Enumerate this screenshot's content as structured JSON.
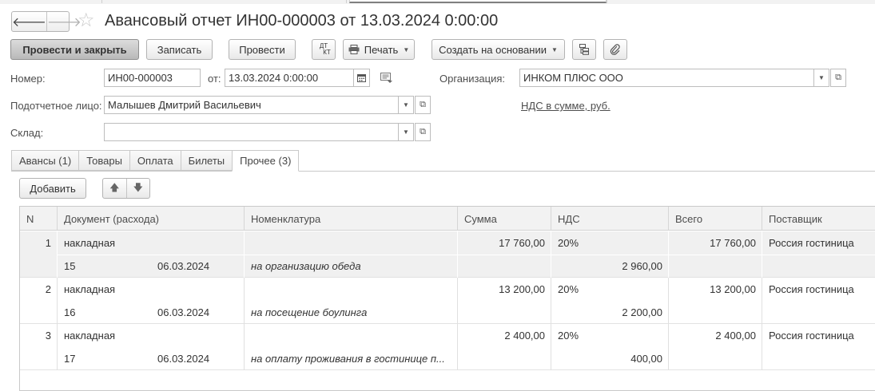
{
  "header": {
    "back": "🡐",
    "forward": "🡒",
    "star": "☆",
    "title": "Авансовый отчет ИН00-000003 от 13.03.2024 0:00:00"
  },
  "toolbar": {
    "post_close": "Провести и закрыть",
    "save": "Записать",
    "post": "Провести",
    "dtkt_top": "ДТ",
    "dtkt_bottom": "КТ",
    "print": "Печать",
    "create_based": "Создать на основании"
  },
  "form": {
    "number_label": "Номер:",
    "number_value": "ИН00-000003",
    "date_label": "от:",
    "date_value": "13.03.2024  0:00:00",
    "org_label": "Организация:",
    "org_value": "ИНКОМ ПЛЮС ООО",
    "person_label": "Подотчетное лицо:",
    "person_value": "Малышев Дмитрий Васильевич",
    "vat_link": "НДС в сумме, руб.",
    "warehouse_label": "Склад:",
    "warehouse_value": ""
  },
  "tabs": [
    "Авансы (1)",
    "Товары",
    "Оплата",
    "Билеты",
    "Прочее (3)"
  ],
  "active_tab": 4,
  "table_toolbar": {
    "add": "Добавить"
  },
  "table": {
    "columns": [
      "N",
      "Документ (расхода)",
      "Номенклатура",
      "Сумма",
      "НДС",
      "Всего",
      "Поставщик"
    ],
    "rows": [
      {
        "n": "1",
        "doc_type": "накладная",
        "doc_num": "15",
        "doc_date": "06.03.2024",
        "nomenclature": "на организацию обеда",
        "sum": "17 760,00",
        "vat_rate": "20%",
        "vat_sum": "2 960,00",
        "total": "17 760,00",
        "supplier": "Россия гостиница"
      },
      {
        "n": "2",
        "doc_type": "накладная",
        "doc_num": "16",
        "doc_date": "06.03.2024",
        "nomenclature": "на посещение боулинга",
        "sum": "13 200,00",
        "vat_rate": "20%",
        "vat_sum": "2 200,00",
        "total": "13 200,00",
        "supplier": "Россия гостиница"
      },
      {
        "n": "3",
        "doc_type": "накладная",
        "doc_num": "17",
        "doc_date": "06.03.2024",
        "nomenclature": "на оплату проживания в гостинице п...",
        "sum": "2 400,00",
        "vat_rate": "20%",
        "vat_sum": "400,00",
        "total": "2 400,00",
        "supplier": "Россия гостиница"
      }
    ]
  }
}
